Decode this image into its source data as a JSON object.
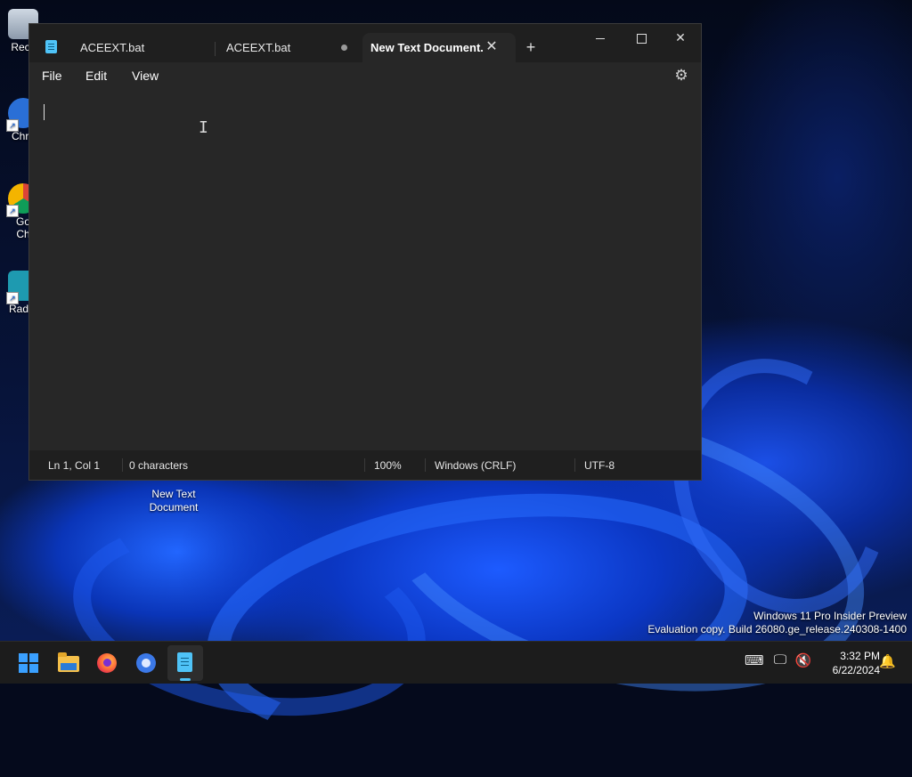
{
  "desktop": {
    "icons": [
      {
        "label": "Recy"
      },
      {
        "label": "Chro"
      },
      {
        "label": "Go\nCh"
      },
      {
        "label": "Radm"
      }
    ],
    "new_text_document_icon": {
      "label": "New Text Document"
    },
    "watermark": {
      "line1": "Windows 11 Pro Insider Preview",
      "line2": "Evaluation copy. Build 26080.ge_release.240308-1400"
    }
  },
  "notepad": {
    "tabs": [
      {
        "label": "ACEEXT.bat"
      },
      {
        "label": "ACEEXT.bat",
        "unsaved": true
      },
      {
        "label": "New Text Document.",
        "active": true
      }
    ],
    "new_tab_label": "+",
    "menu": {
      "file": "File",
      "edit": "Edit",
      "view": "View"
    },
    "editor": {
      "content": ""
    },
    "status": {
      "position": "Ln 1, Col 1",
      "characters": "0 characters",
      "zoom": "100%",
      "line_ending": "Windows (CRLF)",
      "encoding": "UTF-8"
    },
    "icons": {
      "settings": "gear-icon",
      "close_tab": "close-icon",
      "minimize": "minimize-icon",
      "maximize": "maximize-icon",
      "close_window": "close-icon"
    }
  },
  "taskbar": {
    "apps": [
      "start",
      "file-explorer",
      "firefox",
      "chrome",
      "notepad"
    ],
    "clock": {
      "time": "3:32 PM",
      "date": "6/22/2024"
    }
  },
  "colors": {
    "window_bg": "#272727",
    "titlebar_bg": "#1f1f1f",
    "accent": "#4fc3f7",
    "taskbar_bg": "#1c1c1c"
  }
}
